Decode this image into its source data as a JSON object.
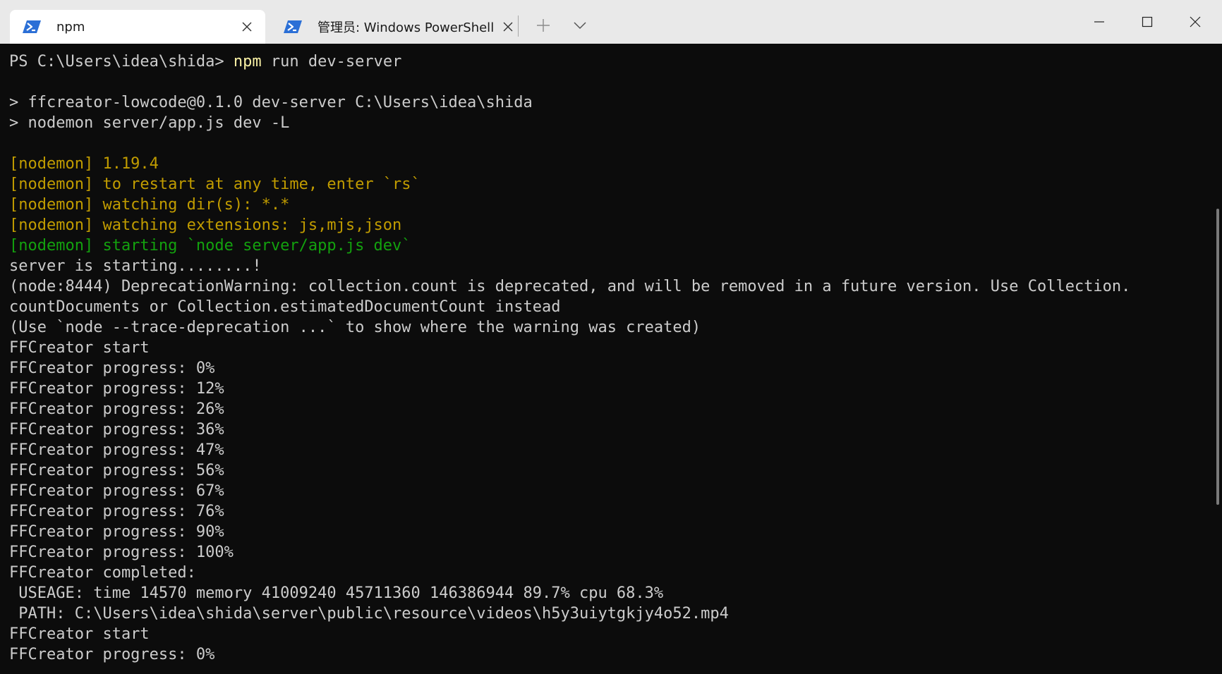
{
  "tabs": [
    {
      "title": "npm",
      "icon": "powershell-icon",
      "active": true
    },
    {
      "title": "管理员: Windows PowerShell",
      "icon": "powershell-icon",
      "active": false
    }
  ],
  "titlebar": {
    "new_tab_symbol": "+",
    "close_symbol": "✕"
  },
  "colors": {
    "terminal_bg": "#0c0c0c",
    "default_text": "#cccccc",
    "nodemon_yellow": "#c19c00",
    "nodemon_green": "#13a10e",
    "command_highlight": "#f9f1a5",
    "powershell_icon_blue": "#2b6fd6"
  },
  "terminal": {
    "prompt": "PS C:\\Users\\idea\\shida> ",
    "command_name": "npm",
    "command_args": " run dev-server",
    "script_header_1": "> ffcreator-lowcode@0.1.0 dev-server C:\\Users\\idea\\shida",
    "script_header_2": "> nodemon server/app.js dev -L",
    "nodemon_version": "[nodemon] 1.19.4",
    "nodemon_restart": "[nodemon] to restart at any time, enter `rs`",
    "nodemon_watch_dir": "[nodemon] watching dir(s): *.*",
    "nodemon_watch_ext": "[nodemon] watching extensions: js,mjs,json",
    "nodemon_starting": "[nodemon] starting `node server/app.js dev`",
    "server_starting": "server is starting........!",
    "deprecation_1": "(node:8444) DeprecationWarning: collection.count is deprecated, and will be removed in a future version. Use Collection.",
    "deprecation_2": "countDocuments or Collection.estimatedDocumentCount instead",
    "deprecation_3": "(Use `node --trace-deprecation ...` to show where the warning was created)",
    "ff_start_1": "FFCreator start",
    "progress_lines": [
      "FFCreator progress: 0%",
      "FFCreator progress: 12%",
      "FFCreator progress: 26%",
      "FFCreator progress: 36%",
      "FFCreator progress: 47%",
      "FFCreator progress: 56%",
      "FFCreator progress: 67%",
      "FFCreator progress: 76%",
      "FFCreator progress: 90%",
      "FFCreator progress: 100%"
    ],
    "ff_completed": "FFCreator completed:",
    "useage": " USEAGE: time 14570 memory 41009240 45711360 146386944 89.7% cpu 68.3%",
    "path": " PATH: C:\\Users\\idea\\shida\\server\\public\\resource\\videos\\h5y3uiytgkjy4o52.mp4",
    "ff_start_2": "FFCreator start",
    "ff_progress_last": "FFCreator progress: 0%"
  }
}
